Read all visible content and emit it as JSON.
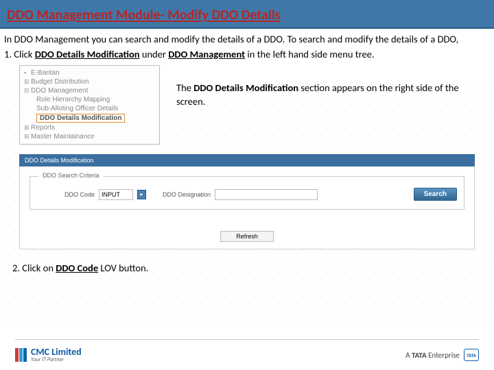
{
  "title": "DDO Management Module- Modify DDO Details",
  "intro": {
    "line1": "In DDO Management you can search and modify the details of a DDO. To search and modify the details of a DDO,",
    "step1_pre": "1. Click ",
    "step1_bold1": "DDO Details Modification",
    "step1_mid": " under ",
    "step1_bold2": "DDO Management",
    "step1_post": " in the left hand side menu tree."
  },
  "tree": {
    "items": [
      {
        "label": "E-Bantan",
        "tw": "▪"
      },
      {
        "label": "Budget Distribution",
        "tw": "⊞"
      },
      {
        "label": "DDO Management",
        "tw": "⊟"
      },
      {
        "label": "Reports",
        "tw": "⊞"
      },
      {
        "label": "Master Maintainance",
        "tw": "⊞"
      }
    ],
    "subitems": [
      {
        "label": "Role Hierarchy Mapping"
      },
      {
        "label": "Sub-Alloting Officer Details"
      },
      {
        "label": "DDO Details Modification"
      }
    ]
  },
  "right_note": {
    "pre": "The ",
    "bold": "DDO Details Modification",
    "post": " section appears on the right side of the screen."
  },
  "panel": {
    "header": "DDO Details Modification",
    "legend": "DDO Search Criteria",
    "code_label": "DDO Code",
    "code_value": "INPUT",
    "designation_label": "DDO Designation",
    "designation_value": "",
    "search_btn": "Search",
    "refresh_btn": "Refresh"
  },
  "step2": {
    "pre": "2. Click on ",
    "bold": "DDO Code",
    "post": " LOV button."
  },
  "footer": {
    "brand": "CMC Limited",
    "tagline": "Your IT Partner",
    "right_pre": "A ",
    "right_bold": "TATA",
    "right_post": " Enterprise",
    "tata": "TATA"
  }
}
